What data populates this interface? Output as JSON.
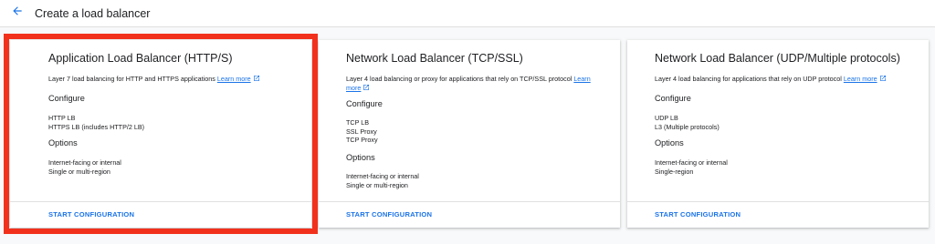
{
  "header": {
    "title": "Create a load balancer",
    "back_icon": "arrow-back-icon"
  },
  "colors": {
    "accent": "#1a73e8",
    "highlight": "#f2311d"
  },
  "cards": [
    {
      "title": "Application Load Balancer (HTTP/S)",
      "description": "Layer 7 load balancing for HTTP and HTTPS applications",
      "learn_more": "Learn more",
      "configure_label": "Configure",
      "configure_items": [
        "HTTP LB",
        "HTTPS LB (includes HTTP/2 LB)"
      ],
      "options_label": "Options",
      "options_items": [
        "Internet-facing or internal",
        "Single or multi-region"
      ],
      "action": "START CONFIGURATION",
      "highlighted": true
    },
    {
      "title": "Network Load Balancer (TCP/SSL)",
      "description": "Layer 4 load balancing or proxy for applications that rely on TCP/SSL protocol",
      "learn_more": "Learn more",
      "configure_label": "Configure",
      "configure_items": [
        "TCP LB",
        "SSL Proxy",
        "TCP Proxy"
      ],
      "options_label": "Options",
      "options_items": [
        "Internet-facing or internal",
        "Single or multi-region"
      ],
      "action": "START CONFIGURATION",
      "highlighted": false
    },
    {
      "title": "Network Load Balancer (UDP/Multiple protocols)",
      "description": "Layer 4 load balancing for applications that rely on UDP protocol",
      "learn_more": "Learn more",
      "configure_label": "Configure",
      "configure_items": [
        "UDP LB",
        "L3 (Multiple protocols)"
      ],
      "options_label": "Options",
      "options_items": [
        "Internet-facing or internal",
        "Single-region"
      ],
      "action": "START CONFIGURATION",
      "highlighted": false
    }
  ]
}
